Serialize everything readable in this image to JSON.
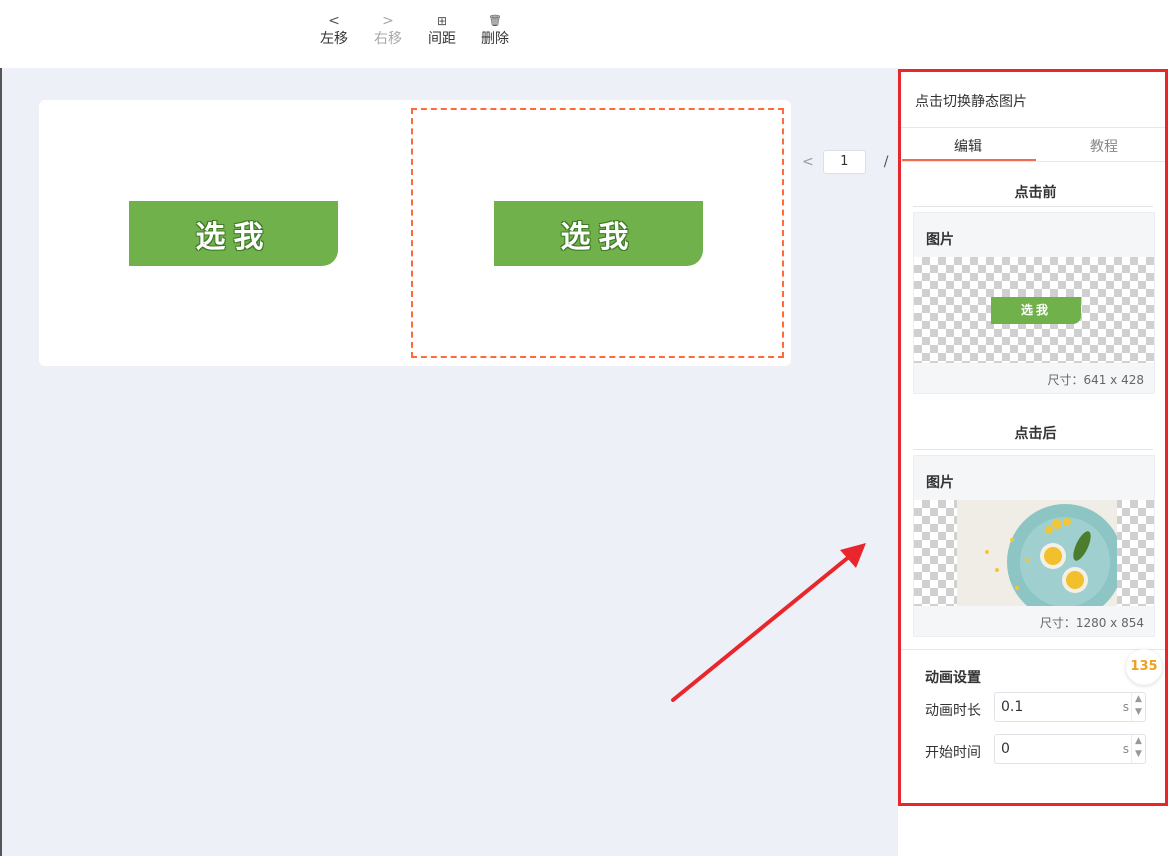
{
  "toolbar": {
    "move_left": {
      "icon": "<",
      "label": "左移"
    },
    "move_right": {
      "icon": ">",
      "label": "右移"
    },
    "spacing": {
      "icon": "⊞",
      "label": "间距"
    },
    "delete": {
      "icon": "🗑",
      "label": "删除"
    }
  },
  "canvas": {
    "slide_button_text": "选我",
    "slide_button_color": "#70b14c",
    "selection_color": "#ff6a3d"
  },
  "pager": {
    "prev_icon": "<",
    "current_page": "1",
    "separator": "/"
  },
  "panel": {
    "title": "点击切换静态图片",
    "tabs": [
      {
        "label": "编辑",
        "active": true
      },
      {
        "label": "教程",
        "active": false
      }
    ],
    "before": {
      "heading": "点击前",
      "image_label": "图片",
      "mini_button_text": "选我",
      "size_text": "尺寸：641 x 428"
    },
    "after": {
      "heading": "点击后",
      "image_label": "图片",
      "size_text": "尺寸：1280 x 854"
    },
    "animation": {
      "title": "动画设置",
      "duration_label": "动画时长",
      "duration_value": "0.1",
      "duration_unit": "s",
      "start_label": "开始时间",
      "start_value": "0",
      "start_unit": "s"
    },
    "logo_text": "135",
    "outline_color": "#e8262b"
  },
  "annotation": {
    "arrow_color": "#e8262b"
  }
}
